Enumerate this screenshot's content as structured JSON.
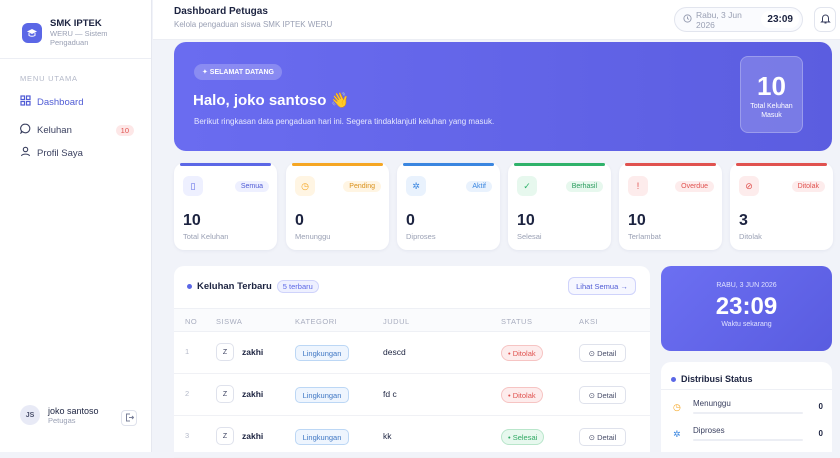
{
  "sidebar": {
    "brand_name": "SMK IPTEK",
    "brand_sub1": "WERU — Sistem",
    "brand_sub2": "Pengaduan",
    "menu_title": "MENU UTAMA",
    "items": [
      {
        "label": "Dashboard",
        "icon": "grid-icon"
      },
      {
        "label": "Keluhan",
        "icon": "chat-icon",
        "badge": "10"
      },
      {
        "label": "Profil Saya",
        "icon": "user-icon"
      }
    ],
    "user_initials": "JS",
    "user_name": "joko santoso",
    "user_role": "Petugas"
  },
  "header": {
    "title": "Dashboard Petugas",
    "subtitle": "Kelola pengaduan siswa SMK IPTEK WERU",
    "date": "Rabu, 3 Jun 2026",
    "time": "23:09"
  },
  "hero": {
    "pill": "✦ SELAMAT DATANG",
    "greeting": "Halo, joko santoso 👋",
    "description": "Berikut ringkasan data pengaduan hari ini. Segera tindaklanjuti keluhan yang masuk.",
    "stat_value": "10",
    "stat_label": "Total Keluhan Masuk"
  },
  "cards": [
    {
      "tag": "Semua",
      "value": "10",
      "label": "Total Keluhan",
      "color": "#5b67e6"
    },
    {
      "tag": "Pending",
      "value": "0",
      "label": "Menunggu",
      "color": "#f5a623"
    },
    {
      "tag": "Aktif",
      "value": "0",
      "label": "Diproses",
      "color": "#3a86e0"
    },
    {
      "tag": "Berhasil",
      "value": "10",
      "label": "Selesai",
      "color": "#2fb26a"
    },
    {
      "tag": "Overdue",
      "value": "10",
      "label": "Terlambat",
      "color": "#e0524f"
    },
    {
      "tag": "Ditolak",
      "value": "3",
      "label": "Ditolak",
      "color": "#e0524f"
    }
  ],
  "table": {
    "title": "Keluhan Terbaru",
    "count": "5 terbaru",
    "view_all": "Lihat Semua →",
    "columns": [
      "NO",
      "SISWA",
      "KATEGORI",
      "JUDUL",
      "STATUS",
      "AKSI"
    ],
    "rows": [
      {
        "no": "1",
        "initial": "Z",
        "siswa": "zakhi",
        "kategori": "Lingkungan",
        "judul": "descd",
        "status": "• Ditolak",
        "aksi": "⊙ Detail"
      },
      {
        "no": "2",
        "initial": "Z",
        "siswa": "zakhi",
        "kategori": "Lingkungan",
        "judul": "fd c",
        "status": "• Ditolak",
        "aksi": "⊙ Detail"
      },
      {
        "no": "3",
        "initial": "Z",
        "siswa": "zakhi",
        "kategori": "Lingkungan",
        "judul": "kk",
        "status": "• Selesai",
        "aksi": "⊙ Detail"
      }
    ]
  },
  "clock": {
    "date": "RABU, 3 JUN 2026",
    "time": "23:09",
    "label": "Waktu sekarang"
  },
  "distribution": {
    "title": "Distribusi Status",
    "rows": [
      {
        "label": "Menunggu",
        "value": "0"
      },
      {
        "label": "Diproses",
        "value": "0"
      }
    ]
  }
}
